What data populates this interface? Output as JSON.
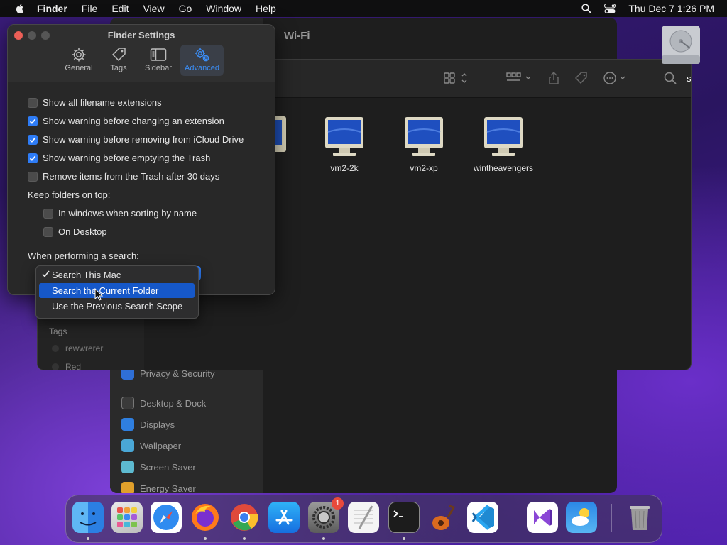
{
  "menubar": {
    "items": [
      "Finder",
      "File",
      "Edit",
      "View",
      "Go",
      "Window",
      "Help"
    ],
    "datetime": "Thu Dec 7  1:26 PM"
  },
  "settings_window": {
    "title": "Wi-Fi",
    "sidebar_items": [
      "Privacy & Security",
      "Desktop & Dock",
      "Displays",
      "Wallpaper",
      "Screen Saver",
      "Energy Saver"
    ]
  },
  "finder": {
    "files": [
      "vm2-2k",
      "vm2-xp",
      "wintheavengers"
    ],
    "sidebar": {
      "tags_header": "Tags",
      "tags": [
        "rewwrerer",
        "Red"
      ]
    }
  },
  "desktop": {
    "disk_label": "s"
  },
  "dialog": {
    "title": "Finder Settings",
    "tabs": [
      "General",
      "Tags",
      "Sidebar",
      "Advanced"
    ],
    "active_tab": "Advanced",
    "options": [
      {
        "label": "Show all filename extensions",
        "checked": false
      },
      {
        "label": "Show warning before changing an extension",
        "checked": true
      },
      {
        "label": "Show warning before removing from iCloud Drive",
        "checked": true
      },
      {
        "label": "Show warning before emptying the Trash",
        "checked": true
      },
      {
        "label": "Remove items from the Trash after 30 days",
        "checked": false
      }
    ],
    "keep_folders_label": "Keep folders on top:",
    "keep_folders_options": [
      {
        "label": "In windows when sorting by name",
        "checked": false
      },
      {
        "label": "On Desktop",
        "checked": false
      }
    ],
    "search_label": "When performing a search:"
  },
  "popup": {
    "items": [
      "Search This Mac",
      "Search the Current Folder",
      "Use the Previous Search Scope"
    ],
    "selected": "Search This Mac",
    "highlighted": "Search the Current Folder"
  },
  "dock": {
    "badge": "1",
    "apps": [
      "finder-icon",
      "launchpad-icon",
      "safari-icon",
      "firefox-icon",
      "chrome-icon",
      "app-store-icon",
      "system-settings-icon",
      "textedit-icon",
      "terminal-icon",
      "garageband-icon",
      "vscode-icon",
      "visual-studio-icon",
      "weather-icon",
      "trash-icon"
    ]
  },
  "colors": {
    "accent": "#2e7cf6",
    "highlight": "#1658c9",
    "dialog_bg": "#282828"
  }
}
